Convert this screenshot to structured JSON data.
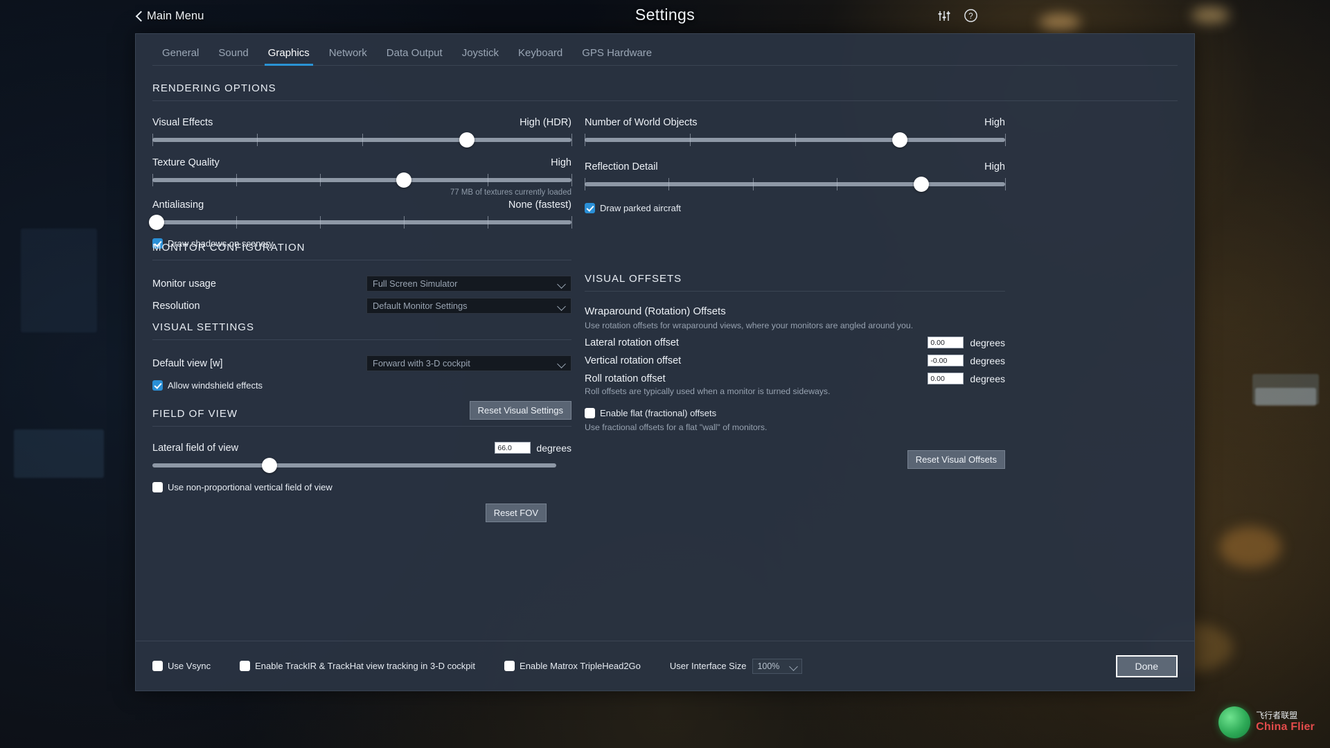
{
  "header": {
    "back_label": "Main Menu",
    "title": "Settings",
    "sliders_icon": "sliders-icon",
    "help_icon": "help-icon"
  },
  "tabs": [
    {
      "label": "General",
      "active": false
    },
    {
      "label": "Sound",
      "active": false
    },
    {
      "label": "Graphics",
      "active": true
    },
    {
      "label": "Network",
      "active": false
    },
    {
      "label": "Data Output",
      "active": false
    },
    {
      "label": "Joystick",
      "active": false
    },
    {
      "label": "Keyboard",
      "active": false
    },
    {
      "label": "GPS Hardware",
      "active": false
    }
  ],
  "rendering": {
    "heading": "RENDERING OPTIONS",
    "visual_effects": {
      "label": "Visual Effects",
      "value": "High (HDR)",
      "percent": 75
    },
    "texture_quality": {
      "label": "Texture Quality",
      "value": "High",
      "percent": 60,
      "hint": "77 MB of textures currently loaded"
    },
    "antialiasing": {
      "label": "Antialiasing",
      "value": "None (fastest)",
      "percent": 1
    },
    "draw_shadows": {
      "label": "Draw shadows on scenery",
      "checked": true
    },
    "world_objects": {
      "label": "Number of World Objects",
      "value": "High",
      "percent": 75
    },
    "reflection_detail": {
      "label": "Reflection Detail",
      "value": "High",
      "percent": 80
    },
    "draw_parked_aircraft": {
      "label": "Draw parked aircraft",
      "checked": true
    }
  },
  "monitor": {
    "heading": "MONITOR CONFIGURATION",
    "usage_label": "Monitor usage",
    "usage_value": "Full Screen Simulator",
    "resolution_label": "Resolution",
    "resolution_value": "Default Monitor Settings"
  },
  "visual_settings": {
    "heading": "VISUAL SETTINGS",
    "default_view_label": "Default view [w]",
    "default_view_value": "Forward with 3-D cockpit",
    "windshield": {
      "label": "Allow windshield effects",
      "checked": true
    },
    "reset_button": "Reset Visual Settings"
  },
  "fov": {
    "heading": "FIELD OF VIEW",
    "lateral_label": "Lateral field of view",
    "lateral_value": "66.0",
    "unit": "degrees",
    "percent": 29,
    "non_proportional": {
      "label": "Use non-proportional vertical field of view",
      "checked": false
    },
    "reset_button": "Reset FOV"
  },
  "offsets": {
    "heading": "VISUAL OFFSETS",
    "wrap_title": "Wraparound (Rotation) Offsets",
    "wrap_desc": "Use rotation offsets for wraparound views, where your monitors are angled around you.",
    "rows": [
      {
        "label": "Lateral rotation offset",
        "value": "0.00",
        "unit": "degrees"
      },
      {
        "label": "Vertical rotation offset",
        "value": "-0.00",
        "unit": "degrees"
      },
      {
        "label": "Roll rotation offset",
        "value": "0.00",
        "unit": "degrees"
      }
    ],
    "roll_desc": "Roll offsets are typically used when a monitor is turned sideways.",
    "flat": {
      "label": "Enable flat (fractional) offsets",
      "checked": false
    },
    "flat_desc": "Use fractional offsets for a flat \"wall\" of monitors.",
    "reset_button": "Reset Visual Offsets"
  },
  "bottom": {
    "vsync": {
      "label": "Use Vsync",
      "checked": false
    },
    "trackir": {
      "label": "Enable TrackIR & TrackHat view tracking in 3-D cockpit",
      "checked": false
    },
    "matrox": {
      "label": "Enable Matrox TripleHead2Go",
      "checked": false
    },
    "ui_size_label": "User Interface Size",
    "ui_size_value": "100%",
    "done_label": "Done"
  },
  "watermark": {
    "cn": "飞行者联盟",
    "en": "China Flier"
  },
  "colors": {
    "panel_bg": "#293341",
    "accent": "#2a93d5",
    "checkbox_on": "#2a8fd6",
    "slider_track": "#8e98a6",
    "text": "#edf1f6",
    "muted": "#97a2b0"
  }
}
